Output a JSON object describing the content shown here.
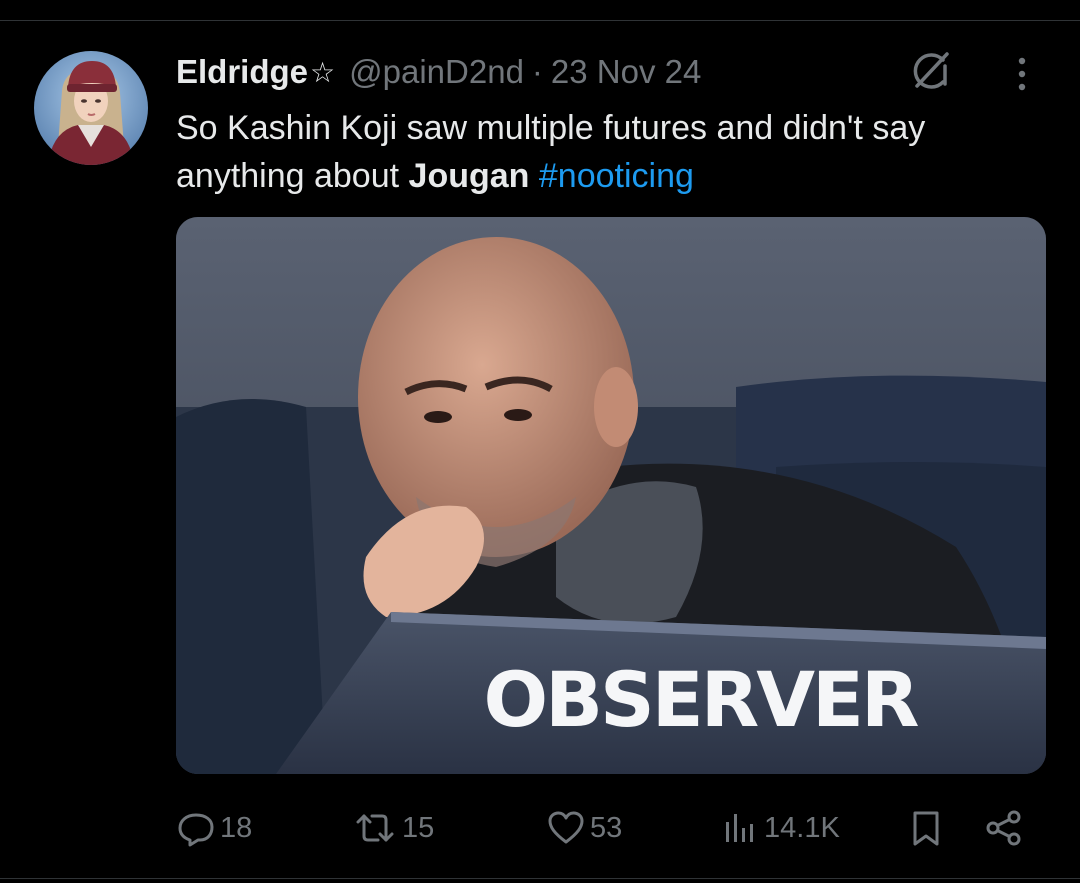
{
  "author": {
    "display_name": "Eldridge",
    "badge_glyph": "☆",
    "handle": "@painD2nd",
    "separator": "·",
    "date": "23 Nov 24"
  },
  "tweet": {
    "text_part1": "So Kashin Koji saw multiple futures and didn't say anything about ",
    "text_bold": "Jougan",
    "text_space": " ",
    "hashtag": "#nooticing"
  },
  "media": {
    "sign_text": "OBSERVER"
  },
  "actions": {
    "replies": "18",
    "reposts": "15",
    "likes": "53",
    "views": "14.1K"
  },
  "icons": {
    "grok": "grok-icon",
    "more": "more-vertical-icon",
    "reply": "reply-icon",
    "repost": "repost-icon",
    "like": "heart-icon",
    "views": "views-icon",
    "bookmark": "bookmark-icon",
    "share": "share-icon"
  },
  "colors": {
    "background": "#000000",
    "text": "#e7e9ea",
    "secondary": "#71767b",
    "hashtag": "#1d9bf0"
  }
}
